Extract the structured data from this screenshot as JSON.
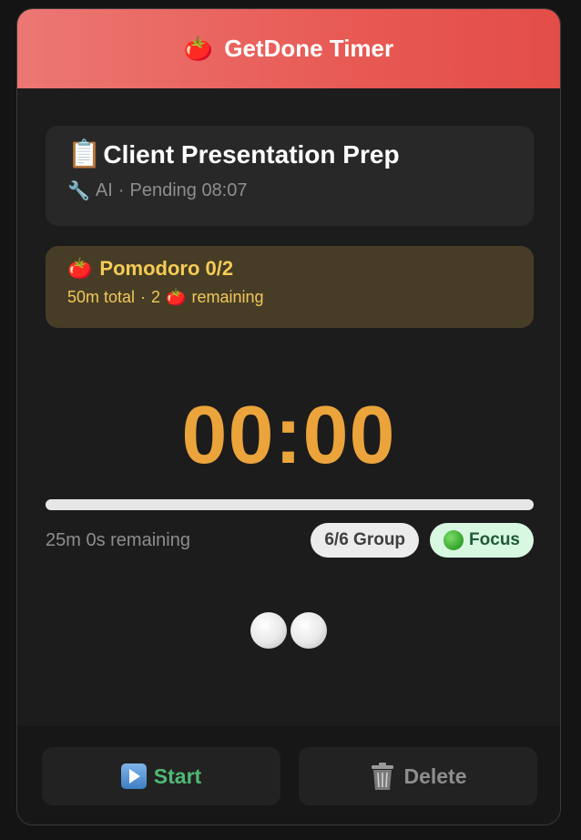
{
  "header": {
    "icon": "tomato-icon",
    "icon_glyph": "🍅",
    "title": "GetDone Timer"
  },
  "task": {
    "icon": "clipboard-icon",
    "icon_glyph": "📋",
    "title": "Client Presentation Prep",
    "tool_icon": "wrench-icon",
    "tool_glyph": "🔧",
    "tool_label": "AI",
    "separator": "·",
    "status": "Pending 08:07"
  },
  "pomodoro": {
    "icon": "tomato-icon",
    "icon_glyph": "🍅",
    "title": "Pomodoro 0/2",
    "total": "50m total",
    "separator": "·",
    "remaining_count": "2",
    "remaining_glyph": "🍅",
    "remaining_label": "remaining"
  },
  "timer": {
    "display": "00:00",
    "progress_fraction": 0,
    "remaining_text": "25m 0s remaining"
  },
  "badges": {
    "group": "6/6 Group",
    "focus": "Focus"
  },
  "session_dots": {
    "count": 2
  },
  "actions": {
    "start_label": "Start",
    "delete_label": "Delete"
  },
  "colors": {
    "header_gradient_start": "#ec7773",
    "header_gradient_end": "#e34d47",
    "timer": "#eba43b",
    "pomodoro_text": "#f5cb55",
    "start_text": "#4fba74",
    "focus_badge_bg": "#d8f8e1"
  }
}
